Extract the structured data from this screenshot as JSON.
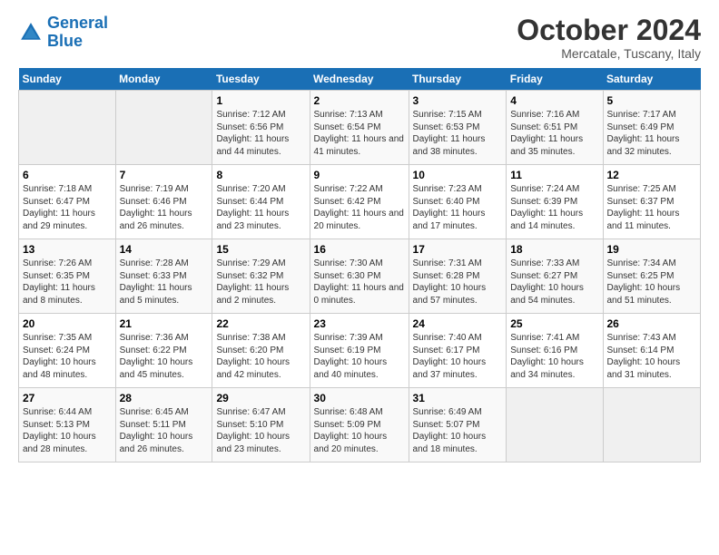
{
  "logo": {
    "line1": "General",
    "line2": "Blue"
  },
  "title": "October 2024",
  "location": "Mercatale, Tuscany, Italy",
  "columns": [
    "Sunday",
    "Monday",
    "Tuesday",
    "Wednesday",
    "Thursday",
    "Friday",
    "Saturday"
  ],
  "weeks": [
    [
      {
        "day": "",
        "sunrise": "",
        "sunset": "",
        "daylight": ""
      },
      {
        "day": "",
        "sunrise": "",
        "sunset": "",
        "daylight": ""
      },
      {
        "day": "1",
        "sunrise": "Sunrise: 7:12 AM",
        "sunset": "Sunset: 6:56 PM",
        "daylight": "Daylight: 11 hours and 44 minutes."
      },
      {
        "day": "2",
        "sunrise": "Sunrise: 7:13 AM",
        "sunset": "Sunset: 6:54 PM",
        "daylight": "Daylight: 11 hours and 41 minutes."
      },
      {
        "day": "3",
        "sunrise": "Sunrise: 7:15 AM",
        "sunset": "Sunset: 6:53 PM",
        "daylight": "Daylight: 11 hours and 38 minutes."
      },
      {
        "day": "4",
        "sunrise": "Sunrise: 7:16 AM",
        "sunset": "Sunset: 6:51 PM",
        "daylight": "Daylight: 11 hours and 35 minutes."
      },
      {
        "day": "5",
        "sunrise": "Sunrise: 7:17 AM",
        "sunset": "Sunset: 6:49 PM",
        "daylight": "Daylight: 11 hours and 32 minutes."
      }
    ],
    [
      {
        "day": "6",
        "sunrise": "Sunrise: 7:18 AM",
        "sunset": "Sunset: 6:47 PM",
        "daylight": "Daylight: 11 hours and 29 minutes."
      },
      {
        "day": "7",
        "sunrise": "Sunrise: 7:19 AM",
        "sunset": "Sunset: 6:46 PM",
        "daylight": "Daylight: 11 hours and 26 minutes."
      },
      {
        "day": "8",
        "sunrise": "Sunrise: 7:20 AM",
        "sunset": "Sunset: 6:44 PM",
        "daylight": "Daylight: 11 hours and 23 minutes."
      },
      {
        "day": "9",
        "sunrise": "Sunrise: 7:22 AM",
        "sunset": "Sunset: 6:42 PM",
        "daylight": "Daylight: 11 hours and 20 minutes."
      },
      {
        "day": "10",
        "sunrise": "Sunrise: 7:23 AM",
        "sunset": "Sunset: 6:40 PM",
        "daylight": "Daylight: 11 hours and 17 minutes."
      },
      {
        "day": "11",
        "sunrise": "Sunrise: 7:24 AM",
        "sunset": "Sunset: 6:39 PM",
        "daylight": "Daylight: 11 hours and 14 minutes."
      },
      {
        "day": "12",
        "sunrise": "Sunrise: 7:25 AM",
        "sunset": "Sunset: 6:37 PM",
        "daylight": "Daylight: 11 hours and 11 minutes."
      }
    ],
    [
      {
        "day": "13",
        "sunrise": "Sunrise: 7:26 AM",
        "sunset": "Sunset: 6:35 PM",
        "daylight": "Daylight: 11 hours and 8 minutes."
      },
      {
        "day": "14",
        "sunrise": "Sunrise: 7:28 AM",
        "sunset": "Sunset: 6:33 PM",
        "daylight": "Daylight: 11 hours and 5 minutes."
      },
      {
        "day": "15",
        "sunrise": "Sunrise: 7:29 AM",
        "sunset": "Sunset: 6:32 PM",
        "daylight": "Daylight: 11 hours and 2 minutes."
      },
      {
        "day": "16",
        "sunrise": "Sunrise: 7:30 AM",
        "sunset": "Sunset: 6:30 PM",
        "daylight": "Daylight: 11 hours and 0 minutes."
      },
      {
        "day": "17",
        "sunrise": "Sunrise: 7:31 AM",
        "sunset": "Sunset: 6:28 PM",
        "daylight": "Daylight: 10 hours and 57 minutes."
      },
      {
        "day": "18",
        "sunrise": "Sunrise: 7:33 AM",
        "sunset": "Sunset: 6:27 PM",
        "daylight": "Daylight: 10 hours and 54 minutes."
      },
      {
        "day": "19",
        "sunrise": "Sunrise: 7:34 AM",
        "sunset": "Sunset: 6:25 PM",
        "daylight": "Daylight: 10 hours and 51 minutes."
      }
    ],
    [
      {
        "day": "20",
        "sunrise": "Sunrise: 7:35 AM",
        "sunset": "Sunset: 6:24 PM",
        "daylight": "Daylight: 10 hours and 48 minutes."
      },
      {
        "day": "21",
        "sunrise": "Sunrise: 7:36 AM",
        "sunset": "Sunset: 6:22 PM",
        "daylight": "Daylight: 10 hours and 45 minutes."
      },
      {
        "day": "22",
        "sunrise": "Sunrise: 7:38 AM",
        "sunset": "Sunset: 6:20 PM",
        "daylight": "Daylight: 10 hours and 42 minutes."
      },
      {
        "day": "23",
        "sunrise": "Sunrise: 7:39 AM",
        "sunset": "Sunset: 6:19 PM",
        "daylight": "Daylight: 10 hours and 40 minutes."
      },
      {
        "day": "24",
        "sunrise": "Sunrise: 7:40 AM",
        "sunset": "Sunset: 6:17 PM",
        "daylight": "Daylight: 10 hours and 37 minutes."
      },
      {
        "day": "25",
        "sunrise": "Sunrise: 7:41 AM",
        "sunset": "Sunset: 6:16 PM",
        "daylight": "Daylight: 10 hours and 34 minutes."
      },
      {
        "day": "26",
        "sunrise": "Sunrise: 7:43 AM",
        "sunset": "Sunset: 6:14 PM",
        "daylight": "Daylight: 10 hours and 31 minutes."
      }
    ],
    [
      {
        "day": "27",
        "sunrise": "Sunrise: 6:44 AM",
        "sunset": "Sunset: 5:13 PM",
        "daylight": "Daylight: 10 hours and 28 minutes."
      },
      {
        "day": "28",
        "sunrise": "Sunrise: 6:45 AM",
        "sunset": "Sunset: 5:11 PM",
        "daylight": "Daylight: 10 hours and 26 minutes."
      },
      {
        "day": "29",
        "sunrise": "Sunrise: 6:47 AM",
        "sunset": "Sunset: 5:10 PM",
        "daylight": "Daylight: 10 hours and 23 minutes."
      },
      {
        "day": "30",
        "sunrise": "Sunrise: 6:48 AM",
        "sunset": "Sunset: 5:09 PM",
        "daylight": "Daylight: 10 hours and 20 minutes."
      },
      {
        "day": "31",
        "sunrise": "Sunrise: 6:49 AM",
        "sunset": "Sunset: 5:07 PM",
        "daylight": "Daylight: 10 hours and 18 minutes."
      },
      {
        "day": "",
        "sunrise": "",
        "sunset": "",
        "daylight": ""
      },
      {
        "day": "",
        "sunrise": "",
        "sunset": "",
        "daylight": ""
      }
    ]
  ]
}
